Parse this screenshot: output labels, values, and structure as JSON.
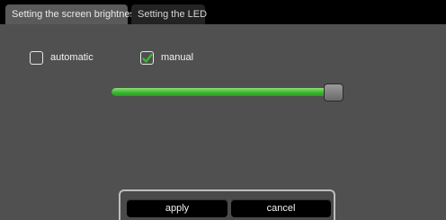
{
  "tabs": {
    "active_label": "Setting the screen brightness",
    "second_label": "Setting the LED"
  },
  "options": {
    "automatic": {
      "label": "automatic",
      "checked": false
    },
    "manual": {
      "label": "manual",
      "checked": true
    }
  },
  "brightness": {
    "value": 0.96
  },
  "buttons": {
    "apply": "apply",
    "cancel": "cancel"
  },
  "colors": {
    "accent": "#3ab82f",
    "panel": "#505050",
    "checkmark": "#3ab82f"
  },
  "icons": {
    "checkbox_checked": "checkmark-icon"
  }
}
